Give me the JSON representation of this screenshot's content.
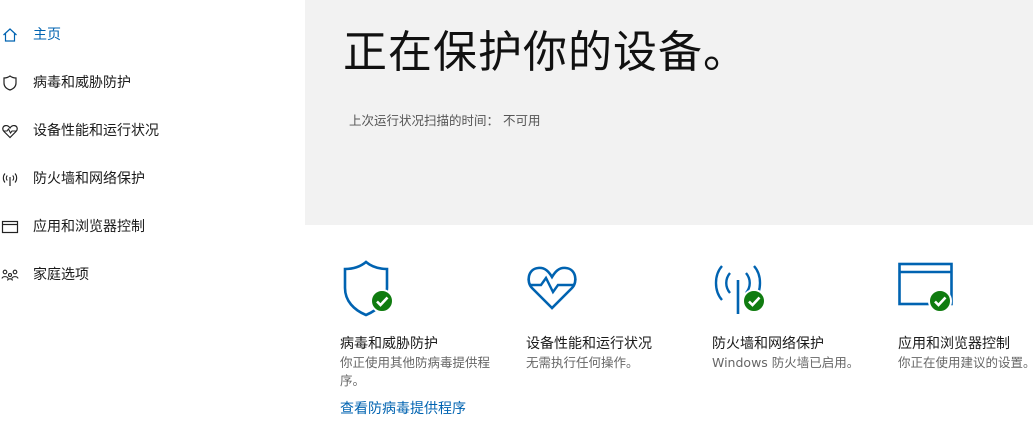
{
  "sidebar": {
    "items": [
      {
        "label": "主页",
        "icon": "home-icon",
        "active": true
      },
      {
        "label": "病毒和威胁防护",
        "icon": "shield-icon"
      },
      {
        "label": "设备性能和运行状况",
        "icon": "heart-pulse-icon"
      },
      {
        "label": "防火墙和网络保护",
        "icon": "antenna-icon"
      },
      {
        "label": "应用和浏览器控制",
        "icon": "browser-window-icon"
      },
      {
        "label": "家庭选项",
        "icon": "family-icon"
      }
    ]
  },
  "hero": {
    "title": "正在保护你的设备。",
    "last_scan": "上次运行状况扫描的时间： 不可用"
  },
  "tiles": [
    {
      "title": "病毒和威胁防护",
      "desc": "你正使用其他防病毒提供程序。",
      "link": "查看防病毒提供程序",
      "icon": "shield-check-icon"
    },
    {
      "title": "设备性能和运行状况",
      "desc": "无需执行任何操作。",
      "icon": "heart-pulse-check-icon"
    },
    {
      "title": "防火墙和网络保护",
      "desc": "Windows 防火墙已启用。",
      "icon": "antenna-check-icon"
    },
    {
      "title": "应用和浏览器控制",
      "desc": "你正在使用建议的设置。",
      "icon": "browser-window-check-icon"
    }
  ],
  "colors": {
    "accent": "#0063b1",
    "ok": "#107c10",
    "hero_bg": "#f2f2f2"
  }
}
